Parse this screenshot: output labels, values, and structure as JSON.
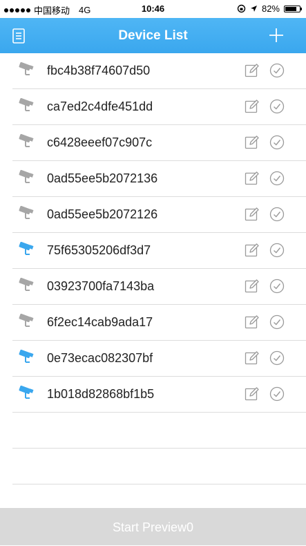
{
  "status_bar": {
    "carrier": "中国移动",
    "network": "4G",
    "time": "10:46",
    "battery": "82%",
    "battery_level": 0.82
  },
  "header": {
    "title": "Device List",
    "menu_icon": "list-icon",
    "add_icon": "plus-icon"
  },
  "devices": [
    {
      "name": "fbc4b38f74607d50",
      "status": "offline"
    },
    {
      "name": "ca7ed2c4dfe451dd",
      "status": "offline"
    },
    {
      "name": "c6428eeef07c907c",
      "status": "offline"
    },
    {
      "name": "0ad55ee5b2072136",
      "status": "offline"
    },
    {
      "name": "0ad55ee5b2072126",
      "status": "offline"
    },
    {
      "name": "75f65305206df3d7",
      "status": "online"
    },
    {
      "name": "03923700fa7143ba",
      "status": "offline"
    },
    {
      "name": "6f2ec14cab9ada17",
      "status": "offline"
    },
    {
      "name": "0e73ecac082307bf",
      "status": "online"
    },
    {
      "name": "1b018d82868bf1b5",
      "status": "online"
    }
  ],
  "colors": {
    "header_blue": "#3aa7ee",
    "camera_online": "#3aa7ee",
    "camera_offline": "#a6a6a6",
    "button_disabled": "#d9d9d9"
  },
  "footer": {
    "preview_label": "Start Preview0"
  }
}
